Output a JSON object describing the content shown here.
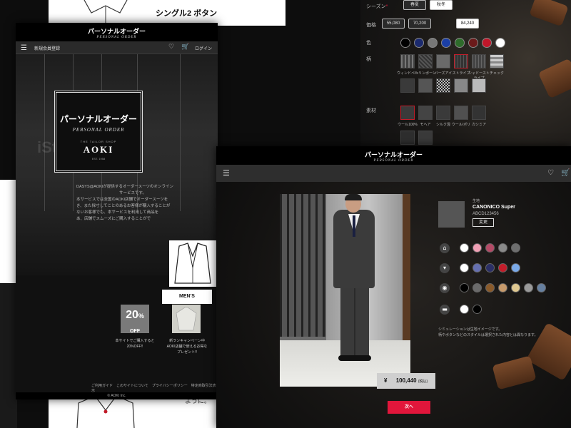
{
  "sheet": {
    "title": "シングル2 ボタン",
    "bottom_text": "ように。"
  },
  "configurator": {
    "rows": [
      {
        "label": "シーズン",
        "required": "*"
      },
      {
        "label": "価格"
      },
      {
        "label": "色"
      },
      {
        "label": "柄"
      },
      {
        "label": "素材"
      }
    ],
    "season_options": [
      "春夏",
      "秋冬"
    ],
    "price_options": [
      "55,080",
      "70,200",
      "84,240"
    ],
    "color_swatches": [
      "#000000",
      "#1b2a6e",
      "#777777",
      "#1b3fa6",
      "#2e6b2b",
      "#6b1a1a",
      "#c0172a",
      "#ffffff"
    ],
    "pattern_labels": [
      "ウィンドペン",
      "ヘリンボーン",
      "バーズアイ",
      "ストライプ",
      "シャドーストライプ",
      "チェック"
    ],
    "material_labels": [
      "ウール100%",
      "モヘア",
      "シルク混",
      "ウール/ポリ",
      "カシミア"
    ]
  },
  "landing": {
    "header_logo": "パーソナルオーダー",
    "header_sub": "PERSONAL ORDER",
    "nav_register": "新規会員登録",
    "nav_login": "ログイン",
    "watermark": "iStock",
    "hero_logo_ja": "パーソナルオーダー",
    "hero_logo_en": "PERSONAL ORDER",
    "hero_tailor": "THE TAILOR SHOP",
    "hero_brand": "AOKI",
    "hero_since": "EST. 1958",
    "desc_lines": [
      "DASYS@AOKIが提供するオーダースーツのオンライン",
      "サービスです。",
      "本サービスでは全国のAOKI店舗でオーダースーツを",
      "き、また採寸してことのあるお客様が購入することが",
      "ないお客様でも、本サービスを利用して商品を",
      "あ、店舗でスムーズにご購入することがで"
    ],
    "mens_button": "MEN'S",
    "promo1_big": "20",
    "promo1_pct": "%",
    "promo1_off": "OFF",
    "promo1_text_1": "本サイトでご購入すると",
    "promo1_text_2": "20%OFF!!",
    "promo2_text_1": "新ランキャンペーン中",
    "promo2_text_2": "AOKI店舗で使えるお得な",
    "promo2_text_3": "プレゼント!!",
    "footer_links": "ご利用ガイド　このサイトについて　プライバシーポリシー　特定商取引法表示",
    "copyright": "© AOKI Inc."
  },
  "product": {
    "header_logo": "パーソナルオーダー",
    "header_sub": "PERSONAL ORDER",
    "fabric_label": "生地",
    "fabric_name": "CANONICO Super",
    "fabric_code": "ABCD123456",
    "change_button": "変更",
    "option_rows": [
      {
        "icon": "jacket-icon",
        "swatches": [
          "#ffffff",
          "#f0a0b5",
          "#b44a66",
          "#8a8a8a",
          "#6e6e6e"
        ]
      },
      {
        "icon": "tie-icon",
        "swatches": [
          "#ffffff",
          "#6670b0",
          "#2b2f66",
          "#c21d2a",
          "#7aa9e8"
        ]
      },
      {
        "icon": "button-icon",
        "swatches": [
          "#000000",
          "#6a6a6a",
          "#8a5a2a",
          "#c79a6b",
          "#e0c890",
          "#9a9a9a",
          "#6680a0"
        ]
      },
      {
        "icon": "shoe-icon",
        "swatches": [
          "#ffffff",
          "#000000"
        ]
      }
    ],
    "price_symbol": "¥",
    "price": "100,440",
    "price_tax": "(税込)",
    "note_1": "シミュレーションは生地イメージです。",
    "note_2": "柄やボタンなどのスタイルは選択された内容とは異なります。",
    "next_button": "次へ"
  }
}
